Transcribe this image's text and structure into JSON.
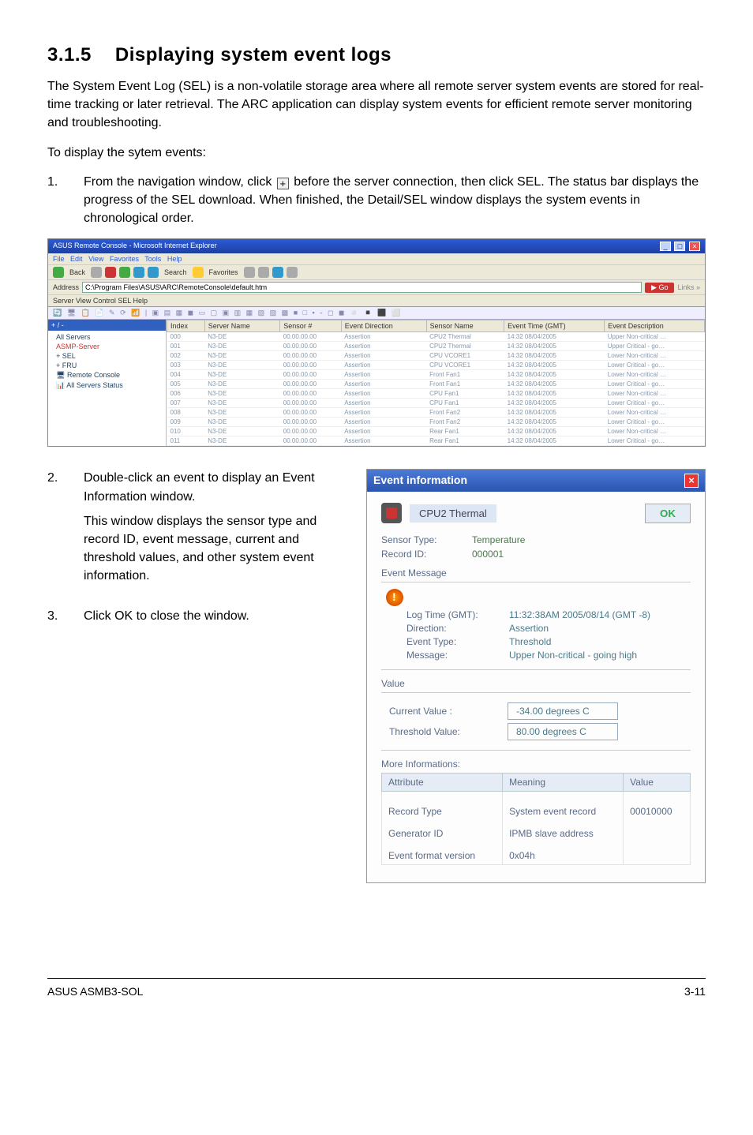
{
  "section": {
    "number": "3.1.5",
    "title": "Displaying system event logs"
  },
  "paragraphs": {
    "intro": "The System Event Log (SEL) is a non-volatile storage area where all remote server system events are stored for real-time tracking or later retrieval. The ARC application can display system events for efficient remote server monitoring and troubleshooting.",
    "lead": "To display the sytem events:"
  },
  "steps": {
    "s1_num": "1.",
    "s1_text_a": "From the navigation window, click ",
    "s1_text_b": " before the server connection, then click SEL. The status bar displays the progress of the SEL download. When finished, the Detail/SEL window displays the system events in chronological order.",
    "s2_num": "2.",
    "s2_text": "Double-click an event to display an Event Information window.",
    "s2_para": "This window displays the sensor type and record ID, event message, current and threshold values, and other system event information.",
    "s3_num": "3.",
    "s3_text": "Click OK to close the window."
  },
  "sel_window": {
    "title": "ASUS Remote Console - Microsoft Internet Explorer",
    "menus": [
      "File",
      "Edit",
      "View",
      "Favorites",
      "Tools",
      "Help"
    ],
    "tool_labels": {
      "back": "Back",
      "search": "Search",
      "favorites": "Favorites"
    },
    "address_label": "Address",
    "address_value": "C:\\Program Files\\ASUS\\ARC\\RemoteConsole\\default.htm",
    "go_label": "Go",
    "viewbar": "Server   View   Control   SEL   Help",
    "tree_header": "+ / -",
    "tree_items": [
      "All Servers",
      "ASMP-Server",
      "SEL",
      "FRU",
      "Remote Console",
      "All Servers Status"
    ],
    "columns": [
      "Index",
      "Server Name",
      "Sensor #",
      "Event Direction",
      "Sensor Name",
      "Event Time (GMT)",
      "Event Description"
    ],
    "rows": [
      {
        "idx": "000",
        "srv": "N3-DE",
        "sen": "00.00.00.00",
        "dir": "Assertion",
        "name": "CPU2 Thermal",
        "time": "14:32 08/04/2005",
        "desc": "Upper Non-critical …"
      },
      {
        "idx": "001",
        "srv": "N3-DE",
        "sen": "00.00.00.00",
        "dir": "Assertion",
        "name": "CPU2 Thermal",
        "time": "14:32 08/04/2005",
        "desc": "Upper Critical - go…"
      },
      {
        "idx": "002",
        "srv": "N3-DE",
        "sen": "00.00.00.00",
        "dir": "Assertion",
        "name": "CPU VCORE1",
        "time": "14:32 08/04/2005",
        "desc": "Lower Non-critical …"
      },
      {
        "idx": "003",
        "srv": "N3-DE",
        "sen": "00.00.00.00",
        "dir": "Assertion",
        "name": "CPU VCORE1",
        "time": "14:32 08/04/2005",
        "desc": "Lower Critical - go…"
      },
      {
        "idx": "004",
        "srv": "N3-DE",
        "sen": "00.00.00.00",
        "dir": "Assertion",
        "name": "Front Fan1",
        "time": "14:32 08/04/2005",
        "desc": "Lower Non-critical …"
      },
      {
        "idx": "005",
        "srv": "N3-DE",
        "sen": "00.00.00.00",
        "dir": "Assertion",
        "name": "Front Fan1",
        "time": "14:32 08/04/2005",
        "desc": "Lower Critical - go…"
      },
      {
        "idx": "006",
        "srv": "N3-DE",
        "sen": "00.00.00.00",
        "dir": "Assertion",
        "name": "CPU Fan1",
        "time": "14:32 08/04/2005",
        "desc": "Lower Non-critical …"
      },
      {
        "idx": "007",
        "srv": "N3-DE",
        "sen": "00.00.00.00",
        "dir": "Assertion",
        "name": "CPU Fan1",
        "time": "14:32 08/04/2005",
        "desc": "Lower Critical - go…"
      },
      {
        "idx": "008",
        "srv": "N3-DE",
        "sen": "00.00.00.00",
        "dir": "Assertion",
        "name": "Front Fan2",
        "time": "14:32 08/04/2005",
        "desc": "Lower Non-critical …"
      },
      {
        "idx": "009",
        "srv": "N3-DE",
        "sen": "00.00.00.00",
        "dir": "Assertion",
        "name": "Front Fan2",
        "time": "14:32 08/04/2005",
        "desc": "Lower Critical - go…"
      },
      {
        "idx": "010",
        "srv": "N3-DE",
        "sen": "00.00.00.00",
        "dir": "Assertion",
        "name": "Rear Fan1",
        "time": "14:32 08/04/2005",
        "desc": "Lower Non-critical …"
      },
      {
        "idx": "011",
        "srv": "N3-DE",
        "sen": "00.00.00.00",
        "dir": "Assertion",
        "name": "Rear Fan1",
        "time": "14:32 08/04/2005",
        "desc": "Lower Critical - go…"
      }
    ]
  },
  "event_dialog": {
    "title": "Event information",
    "header_label": "CPU2 Thermal",
    "ok": "OK",
    "sensor_type_label": "Sensor Type:",
    "sensor_type_value": "Temperature",
    "record_id_label": "Record ID:",
    "record_id_value": "000001",
    "event_message_label": "Event Message",
    "msg": {
      "log_time_label": "Log Time (GMT):",
      "log_time_value": "11:32:38AM 2005/08/14 (GMT -8)",
      "direction_label": "Direction:",
      "direction_value": "Assertion",
      "event_type_label": "Event Type:",
      "event_type_value": "Threshold",
      "message_label": "Message:",
      "message_value": "Upper Non-critical - going high"
    },
    "value_label": "Value",
    "current_value_label": "Current Value :",
    "current_value": "-34.00 degrees C",
    "threshold_value_label": "Threshold Value:",
    "threshold_value": "80.00 degrees C",
    "more_info_label": "More Informations:",
    "attr_col": "Attribute",
    "meaning_col": "Meaning",
    "value_col": "Value",
    "attrs": [
      {
        "a": "Record Type",
        "m": "System event record",
        "v": ""
      },
      {
        "a": "Generator ID",
        "m": "IPMB slave address",
        "v": "00010000"
      },
      {
        "a": "Event format version",
        "m": "0x04h",
        "v": ""
      }
    ]
  },
  "footer": {
    "left": "ASUS ASMB3-SOL",
    "right": "3-11"
  }
}
